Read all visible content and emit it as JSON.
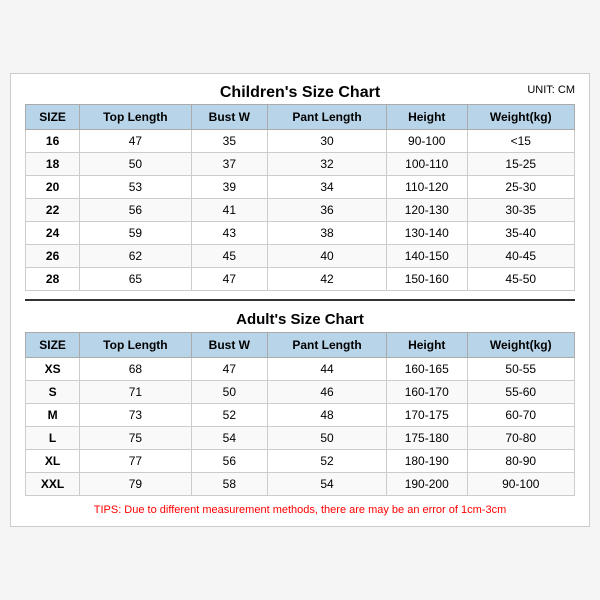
{
  "title": "Children's Size Chart",
  "unit": "UNIT: CM",
  "children_headers": [
    "SIZE",
    "Top Length",
    "Bust W",
    "Pant Length",
    "Height",
    "Weight(kg)"
  ],
  "children_rows": [
    [
      "16",
      "47",
      "35",
      "30",
      "90-100",
      "<15"
    ],
    [
      "18",
      "50",
      "37",
      "32",
      "100-110",
      "15-25"
    ],
    [
      "20",
      "53",
      "39",
      "34",
      "110-120",
      "25-30"
    ],
    [
      "22",
      "56",
      "41",
      "36",
      "120-130",
      "30-35"
    ],
    [
      "24",
      "59",
      "43",
      "38",
      "130-140",
      "35-40"
    ],
    [
      "26",
      "62",
      "45",
      "40",
      "140-150",
      "40-45"
    ],
    [
      "28",
      "65",
      "47",
      "42",
      "150-160",
      "45-50"
    ]
  ],
  "adult_title": "Adult's Size Chart",
  "adult_headers": [
    "SIZE",
    "Top Length",
    "Bust W",
    "Pant Length",
    "Height",
    "Weight(kg)"
  ],
  "adult_rows": [
    [
      "XS",
      "68",
      "47",
      "44",
      "160-165",
      "50-55"
    ],
    [
      "S",
      "71",
      "50",
      "46",
      "160-170",
      "55-60"
    ],
    [
      "M",
      "73",
      "52",
      "48",
      "170-175",
      "60-70"
    ],
    [
      "L",
      "75",
      "54",
      "50",
      "175-180",
      "70-80"
    ],
    [
      "XL",
      "77",
      "56",
      "52",
      "180-190",
      "80-90"
    ],
    [
      "XXL",
      "79",
      "58",
      "54",
      "190-200",
      "90-100"
    ]
  ],
  "tips": "TIPS: Due to different measurement methods, there are may be an error of 1cm-3cm"
}
